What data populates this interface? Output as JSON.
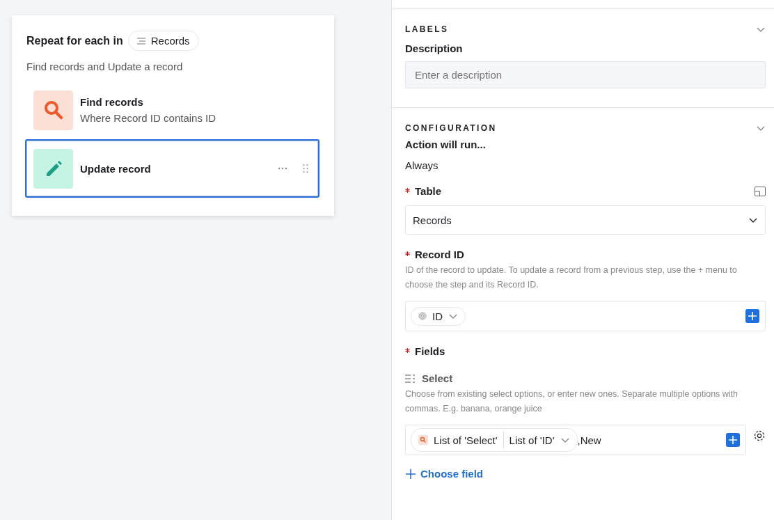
{
  "canvas": {
    "group": {
      "title": "Repeat for each in",
      "source_pill": "Records",
      "description": "Find records and Update a record",
      "steps": [
        {
          "kind": "find",
          "title": "Find records",
          "subtitle": "Where Record ID contains ID",
          "selected": false
        },
        {
          "kind": "update",
          "title": "Update record",
          "selected": true
        }
      ]
    }
  },
  "panel": {
    "labels_section": {
      "heading": "LABELS",
      "expanded": true,
      "description_label": "Description",
      "description_placeholder": "Enter a description"
    },
    "configuration_section": {
      "heading": "CONFIGURATION",
      "expanded": true,
      "run_label": "Action will run...",
      "run_value": "Always",
      "table": {
        "label": "Table",
        "required": true,
        "value": "Records"
      },
      "record_id": {
        "label": "Record ID",
        "required": true,
        "help": "ID of the record to update. To update a record from a previous step, use the + menu to choose the step and its Record ID.",
        "token": "ID"
      },
      "fields": {
        "label": "Fields",
        "required": true,
        "field_name": "Select",
        "help": "Choose from existing select options, or enter new ones. Separate multiple options with commas. E.g. banana, orange juice",
        "token_left": "List of 'Select'",
        "token_right": "List of 'ID'",
        "typed_text": ",New",
        "choose_field": "Choose field"
      }
    }
  }
}
